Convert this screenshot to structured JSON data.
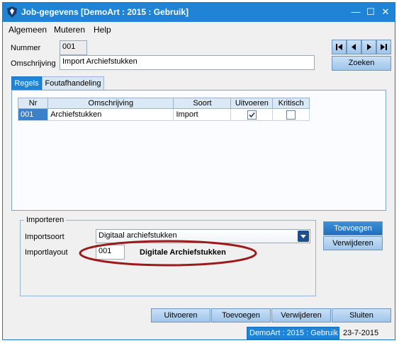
{
  "window": {
    "title": "Job-gegevens  [DemoArt : 2015 : Gebruik]",
    "controls": {
      "minimize": "—",
      "maximize": "☐",
      "close": "✕"
    }
  },
  "menu": {
    "items": [
      {
        "label": "Algemeen"
      },
      {
        "label": "Muteren"
      },
      {
        "label": "Help"
      }
    ]
  },
  "form": {
    "nummer_label": "Nummer",
    "nummer_value": "001",
    "omschrijving_label": "Omschrijving",
    "omschrijving_value": "Import Archiefstukken",
    "zoeken_label": "Zoeken"
  },
  "tabs": [
    {
      "label": "Regels",
      "active": true
    },
    {
      "label": "Foutafhandeling",
      "active": false
    }
  ],
  "grid": {
    "columns": [
      "Nr",
      "Omschrijving",
      "Soort",
      "Uitvoeren",
      "Kritisch"
    ],
    "rows": [
      {
        "nr": "001",
        "omschrijving": "Archiefstukken",
        "soort": "Import",
        "uitvoeren": true,
        "kritisch": false
      }
    ]
  },
  "importeren": {
    "title": "Importeren",
    "importsoort_label": "Importsoort",
    "importsoort_value": "Digitaal archiefstukken",
    "importlayout_label": "Importlayout",
    "importlayout_code": "001",
    "importlayout_name": "Digitale Archiefstukken",
    "toevoegen_label": "Toevoegen",
    "verwijderen_label": "Verwijderen"
  },
  "footer_buttons": {
    "uitvoeren": "Uitvoeren",
    "toevoegen": "Toevoegen",
    "verwijderen": "Verwijderen",
    "sluiten": "Sluiten"
  },
  "status": {
    "context": "DemoArt : 2015 : Gebruik",
    "date": "23-7-2015"
  },
  "colors": {
    "titlebar": "#1f83d6",
    "highlight_ellipse": "#9b1b1b",
    "selected_row": "#3a83cc"
  }
}
